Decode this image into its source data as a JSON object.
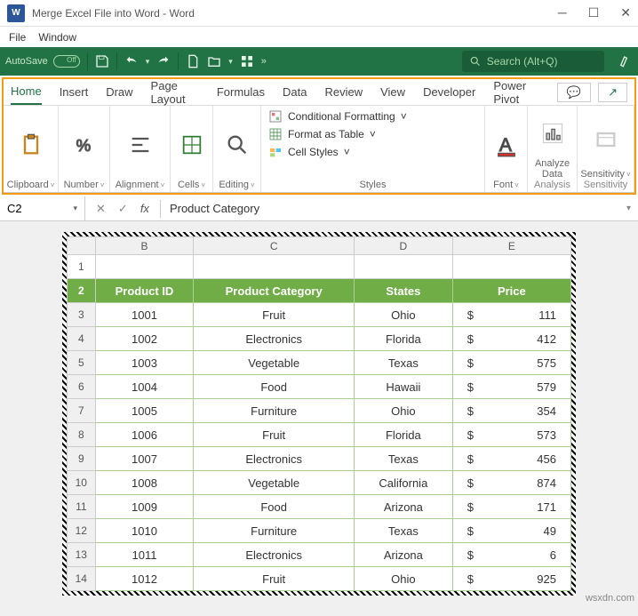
{
  "window": {
    "title": "Merge Excel File into Word - Word",
    "app_icon_text": "W"
  },
  "menubar": [
    "File",
    "Window"
  ],
  "qat": {
    "autosave_label": "AutoSave",
    "search_placeholder": "Search (Alt+Q)"
  },
  "tabs": [
    "Home",
    "Insert",
    "Draw",
    "Page Layout",
    "Formulas",
    "Data",
    "Review",
    "View",
    "Developer",
    "Power Pivot"
  ],
  "active_tab_index": 0,
  "ribbon_groups": {
    "clipboard": "Clipboard",
    "number": "Number",
    "alignment": "Alignment",
    "cells": "Cells",
    "editing": "Editing",
    "font": "Font",
    "analysis": "Analysis",
    "analyze_data": "Analyze Data",
    "sensitivity": "Sensitivity",
    "sensitivity_btn": "Sensitivity"
  },
  "styles": {
    "cond_format": "Conditional Formatting",
    "format_table": "Format as Table",
    "cell_styles": "Cell Styles",
    "label": "Styles"
  },
  "formula_bar": {
    "name": "C2",
    "value": "Product Category"
  },
  "sheet": {
    "col_headers": [
      "B",
      "C",
      "D",
      "E"
    ],
    "header_row": [
      "Product ID",
      "Product Category",
      "States",
      "Price"
    ],
    "rows": [
      {
        "n": 3,
        "id": "1001",
        "cat": "Fruit",
        "state": "Ohio",
        "price": "111"
      },
      {
        "n": 4,
        "id": "1002",
        "cat": "Electronics",
        "state": "Florida",
        "price": "412"
      },
      {
        "n": 5,
        "id": "1003",
        "cat": "Vegetable",
        "state": "Texas",
        "price": "575"
      },
      {
        "n": 6,
        "id": "1004",
        "cat": "Food",
        "state": "Hawaii",
        "price": "579"
      },
      {
        "n": 7,
        "id": "1005",
        "cat": "Furniture",
        "state": "Ohio",
        "price": "354"
      },
      {
        "n": 8,
        "id": "1006",
        "cat": "Fruit",
        "state": "Florida",
        "price": "573"
      },
      {
        "n": 9,
        "id": "1007",
        "cat": "Electronics",
        "state": "Texas",
        "price": "456"
      },
      {
        "n": 10,
        "id": "1008",
        "cat": "Vegetable",
        "state": "California",
        "price": "874"
      },
      {
        "n": 11,
        "id": "1009",
        "cat": "Food",
        "state": "Arizona",
        "price": "171"
      },
      {
        "n": 12,
        "id": "1010",
        "cat": "Furniture",
        "state": "Texas",
        "price": "49"
      },
      {
        "n": 13,
        "id": "1011",
        "cat": "Electronics",
        "state": "Arizona",
        "price": "6"
      },
      {
        "n": 14,
        "id": "1012",
        "cat": "Fruit",
        "state": "Ohio",
        "price": "925"
      }
    ],
    "currency": "$"
  },
  "watermark": "wsxdn.com",
  "caret": "˅"
}
